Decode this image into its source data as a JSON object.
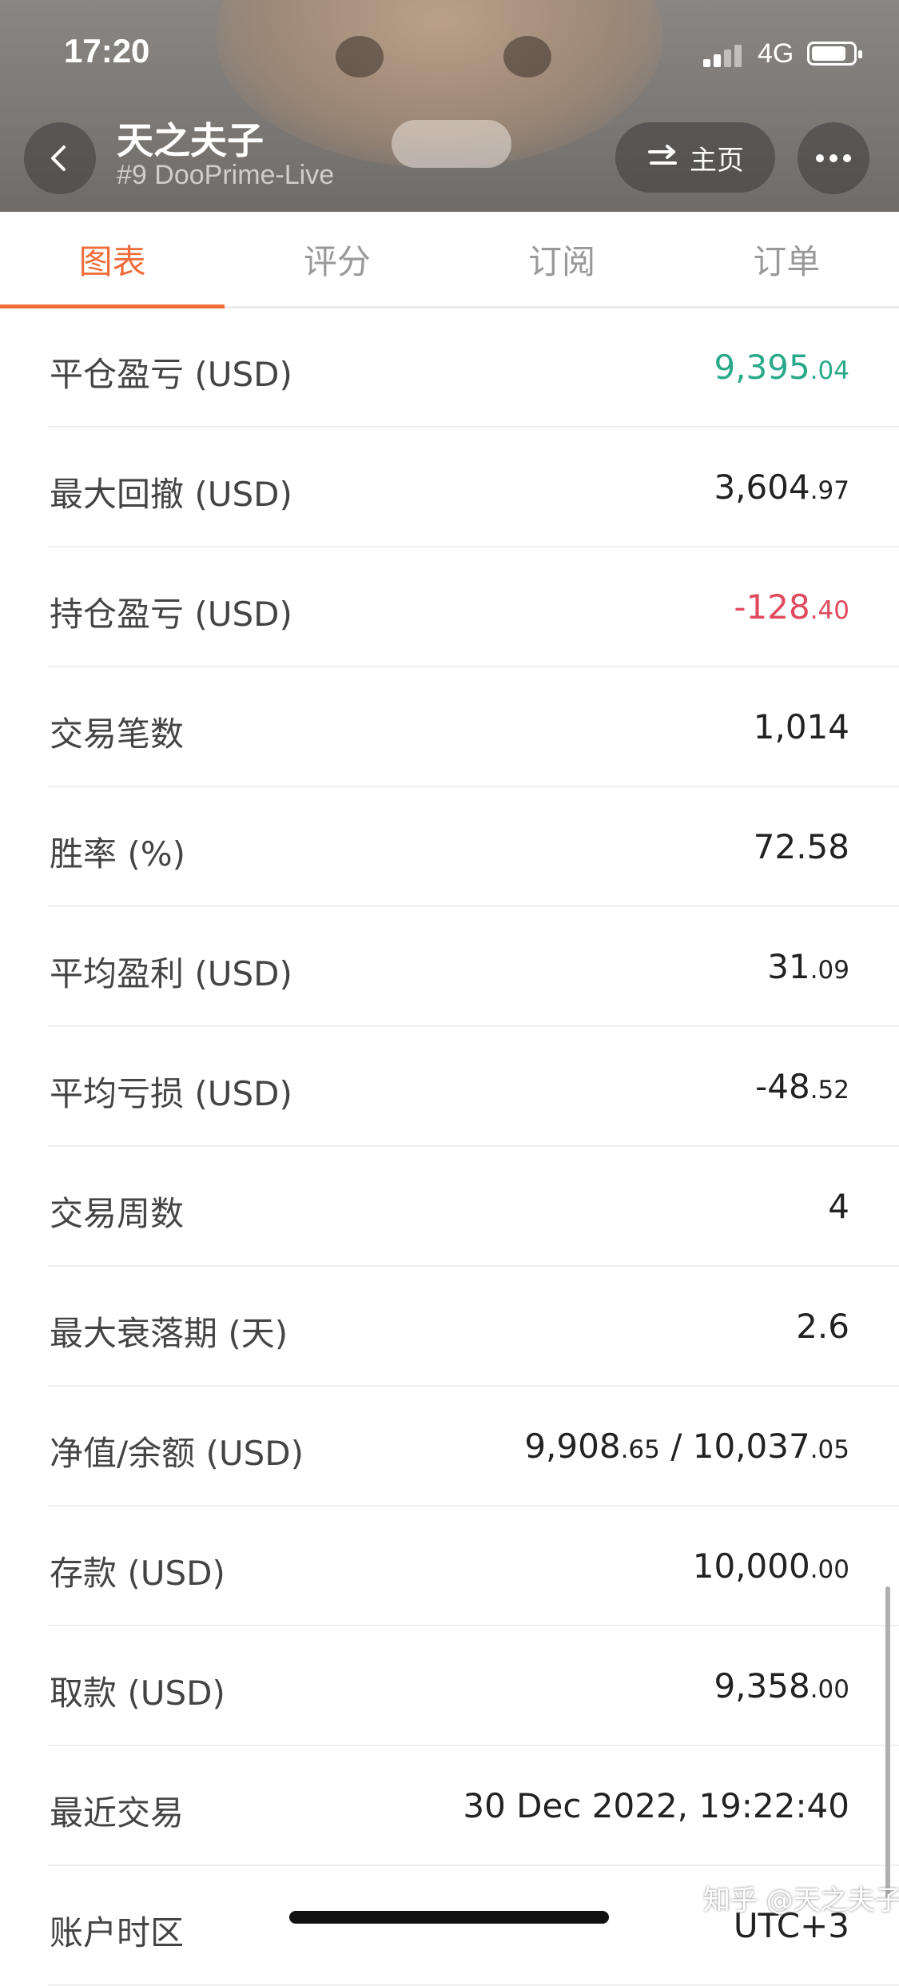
{
  "status_bar": {
    "time": "17:20",
    "network": "4G"
  },
  "header": {
    "title": "天之夫子",
    "subtitle": "#9 DooPrime-Live",
    "home_label": "主页"
  },
  "tabs": [
    {
      "label": "图表",
      "active": true
    },
    {
      "label": "评分",
      "active": false
    },
    {
      "label": "订阅",
      "active": false
    },
    {
      "label": "订单",
      "active": false
    }
  ],
  "stats": [
    {
      "label": "平仓盈亏 (USD)",
      "int": "9,395",
      "dec": ".04",
      "color": "green"
    },
    {
      "label": "最大回撤 (USD)",
      "int": "3,604",
      "dec": ".97",
      "color": "default"
    },
    {
      "label": "持仓盈亏 (USD)",
      "int": "-128",
      "dec": ".40",
      "color": "red"
    },
    {
      "label": "交易笔数",
      "int": "1,014",
      "dec": "",
      "color": "default"
    },
    {
      "label": "胜率 (%)",
      "int": "72.58",
      "dec": "",
      "color": "default"
    },
    {
      "label": "平均盈利 (USD)",
      "int": "31",
      "dec": ".09",
      "color": "default"
    },
    {
      "label": "平均亏损 (USD)",
      "int": "-48",
      "dec": ".52",
      "color": "default"
    },
    {
      "label": "交易周数",
      "int": "4",
      "dec": "",
      "color": "default"
    },
    {
      "label": "最大衰落期 (天)",
      "int": "2.6",
      "dec": "",
      "color": "default"
    },
    {
      "label": "净值/余额 (USD)",
      "int": "9,908",
      "dec": ".65",
      "int2": " / 10,037",
      "dec2": ".05",
      "color": "default"
    },
    {
      "label": "存款 (USD)",
      "int": "10,000",
      "dec": ".00",
      "color": "default"
    },
    {
      "label": "取款 (USD)",
      "int": "9,358",
      "dec": ".00",
      "color": "default"
    },
    {
      "label": "最近交易",
      "int": "30 Dec 2022, 19:22:40",
      "dec": "",
      "color": "default"
    },
    {
      "label": "账户时区",
      "int": "UTC+3",
      "dec": "",
      "color": "default"
    }
  ],
  "watermark": "知乎 @天之夫子",
  "colors": {
    "accent": "#ef6d3b",
    "positive": "#2aa98a",
    "negative": "#e0495e"
  }
}
